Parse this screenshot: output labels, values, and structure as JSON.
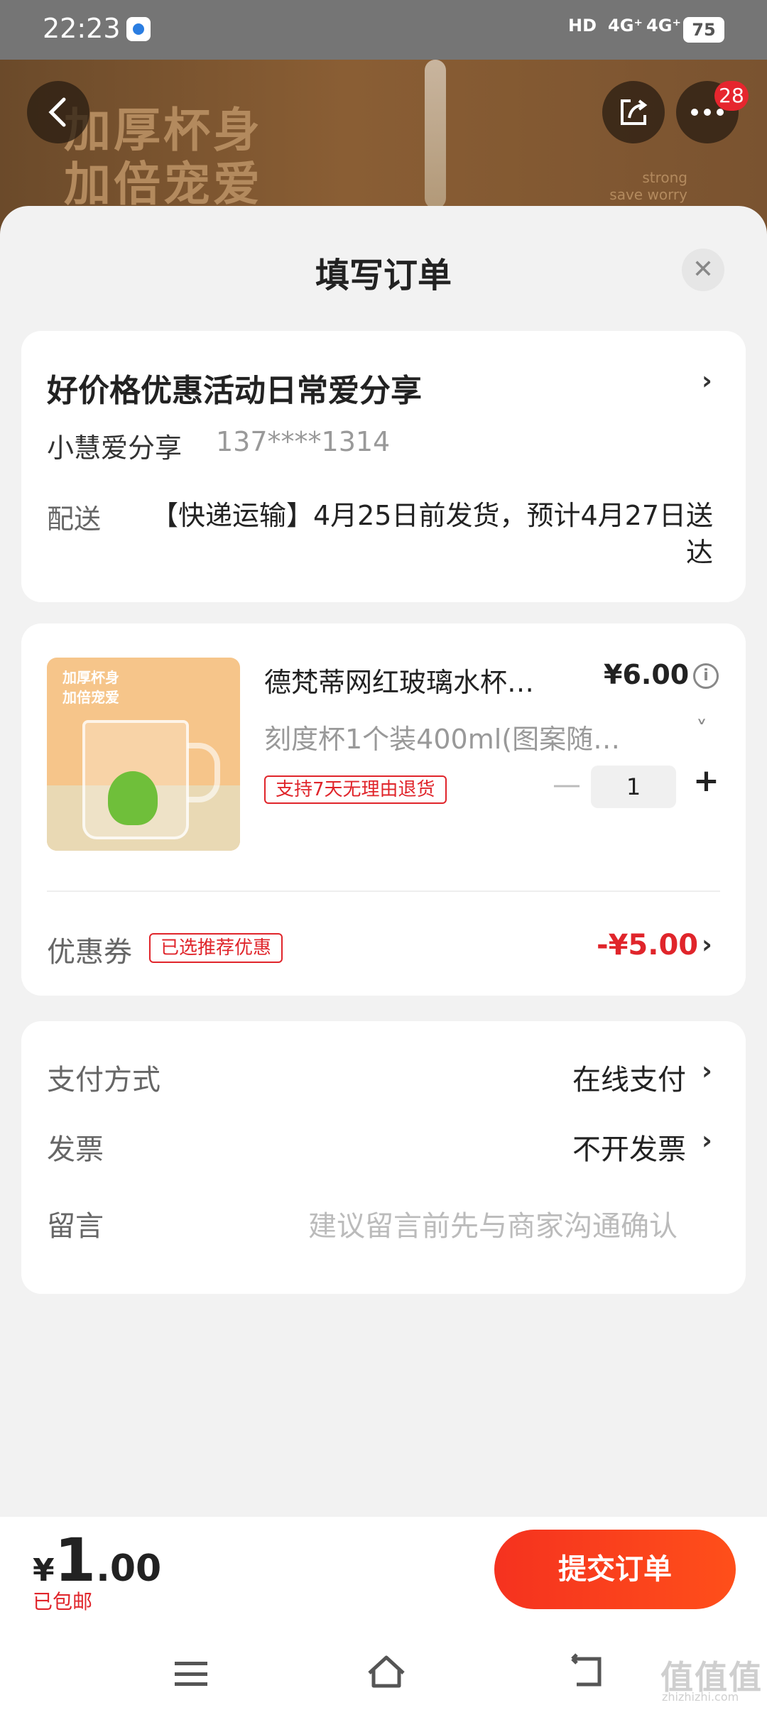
{
  "status_bar": {
    "time": "22:23",
    "hd": "HD",
    "sig1": "4G⁺",
    "sig2": "4G⁺",
    "battery": "75"
  },
  "banner": {
    "line1": "加厚杯身",
    "line2": "加倍宠爱",
    "en1": "strong",
    "en2": "save worry",
    "badge_count": "28"
  },
  "sheet": {
    "title": "填写订单",
    "close": "✕"
  },
  "address": {
    "title": "好价格优惠活动日常爱分享",
    "name": "小慧爱分享",
    "phone": "137****1314",
    "delivery_label": "配送",
    "delivery_text": "【快递运输】4月25日前发货，预计4月27日送达"
  },
  "product": {
    "thumb_line1": "加厚杯身",
    "thumb_line2": "加倍宠爱",
    "name": "德梵蒂网红玻璃水杯…",
    "price": "¥6.00",
    "spec": "刻度杯1个装400ml(图案随…",
    "return_tag": "支持7天无理由退货",
    "quantity": "1",
    "coupon_label": "优惠券",
    "coupon_tag": "已选推荐优惠",
    "coupon_value": "-¥5.00"
  },
  "options": {
    "payment_label": "支付方式",
    "payment_value": "在线支付",
    "invoice_label": "发票",
    "invoice_value": "不开发票",
    "message_label": "留言",
    "message_placeholder": "建议留言前先与商家沟通确认"
  },
  "bottom": {
    "currency": "¥",
    "total_int": "1",
    "total_dec": ".00",
    "shipping": "已包邮",
    "submit": "提交订单"
  },
  "watermark": {
    "main": "值值值",
    "sub": "zhizhizhi.com"
  },
  "colors": {
    "accent": "#e0252b",
    "button_gradient_start": "#f5321f",
    "button_gradient_end": "#ff4f1a"
  }
}
